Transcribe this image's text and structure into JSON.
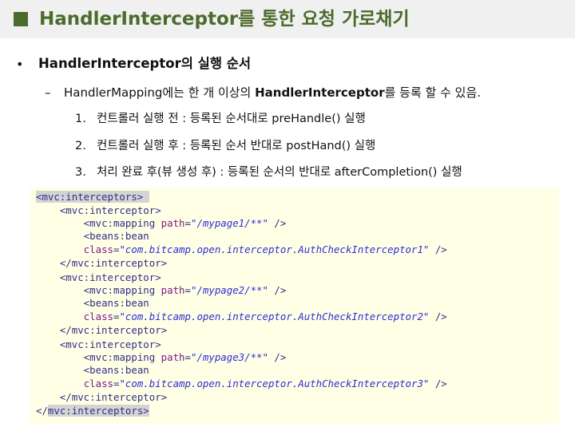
{
  "title": "HandlerInterceptor를 통한 요청 가로채기",
  "colors": {
    "title_accent": "#4b6b2c",
    "title_bar_bg": "#f0f0f0",
    "code_bg": "#ffffe6",
    "code_tag": "#2f2f86",
    "code_attr": "#7b1a8a",
    "code_value": "#2d2dd6"
  },
  "bullet": {
    "marker": "•",
    "text": "HandlerInterceptor의 실행 순서"
  },
  "sub": {
    "marker": "–",
    "prefix": "HandlerMapping에는 한 개 이상의 ",
    "bold": "HandlerInterceptor",
    "suffix": "를 등록 할 수 있음."
  },
  "steps": [
    {
      "num": "1.",
      "text": "컨트롤러 실행 전 : 등록된 순서대로 preHandle() 실행"
    },
    {
      "num": "2.",
      "text": "컨트롤러 실행 후 : 등록된 순서 반대로 postHand() 실행"
    },
    {
      "num": "3.",
      "text": "처리 완료 후(뷰 생성 후) : 등록된 순서의 반대로 afterCompletion() 실행"
    }
  ],
  "code": {
    "open_root": "<mvc:interceptors>",
    "close_root_a": "</",
    "close_root_b": "mvc:interceptors>",
    "interceptor_open": "<mvc:interceptor>",
    "interceptor_close": "</mvc:interceptor>",
    "mapping_start": "<mvc:mapping ",
    "path_attr": "path",
    "eq": "=",
    "selfclose": " />",
    "bean_open": "<beans:bean",
    "class_attr": "class",
    "blocks": [
      {
        "path": "\"/mypage1/**\"",
        "class": "\"com.bitcamp.open.interceptor.AuthCheckInterceptor1\""
      },
      {
        "path": "\"/mypage2/**\"",
        "class": "\"com.bitcamp.open.interceptor.AuthCheckInterceptor2\""
      },
      {
        "path": "\"/mypage3/**\"",
        "class": "\"com.bitcamp.open.interceptor.AuthCheckInterceptor3\""
      }
    ]
  }
}
